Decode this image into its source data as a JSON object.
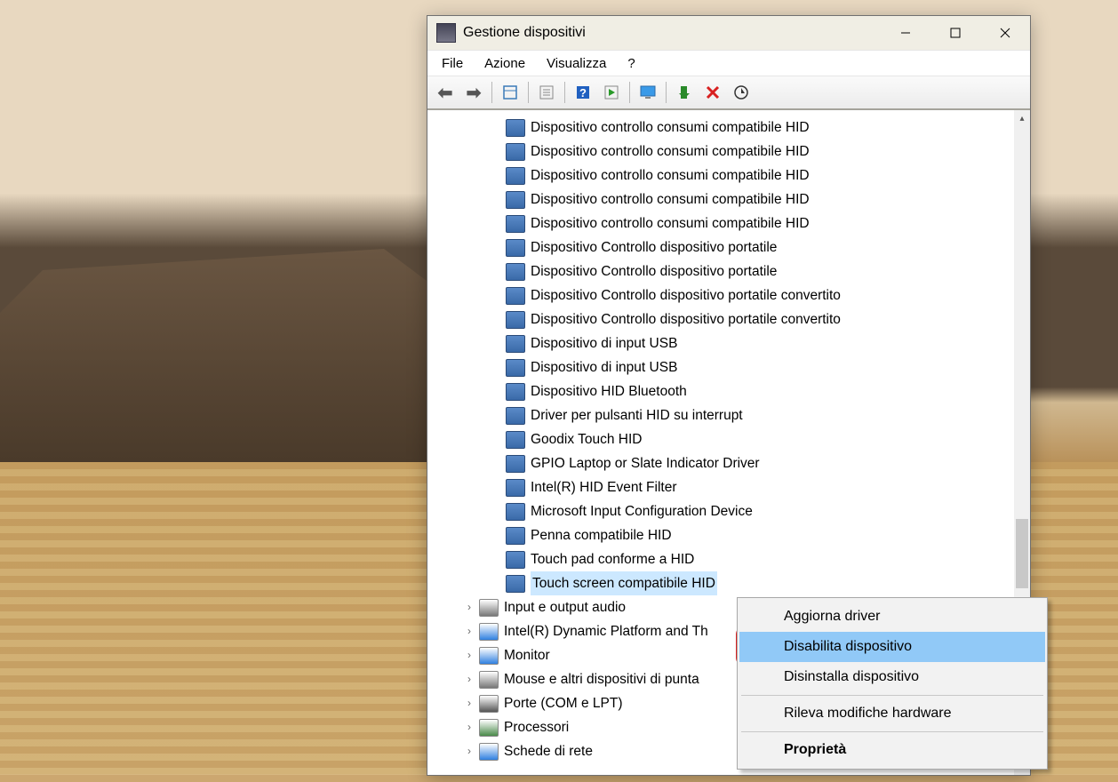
{
  "window": {
    "title": "Gestione dispositivi"
  },
  "menu": {
    "file": "File",
    "action": "Azione",
    "view": "Visualizza",
    "help": "?"
  },
  "toolbar": {
    "back": "◄",
    "forward": "►"
  },
  "devices": [
    {
      "label": "Dispositivo controllo consumi compatibile HID"
    },
    {
      "label": "Dispositivo controllo consumi compatibile HID"
    },
    {
      "label": "Dispositivo controllo consumi compatibile HID"
    },
    {
      "label": "Dispositivo controllo consumi compatibile HID"
    },
    {
      "label": "Dispositivo controllo consumi compatibile HID"
    },
    {
      "label": "Dispositivo Controllo dispositivo portatile"
    },
    {
      "label": "Dispositivo Controllo dispositivo portatile"
    },
    {
      "label": "Dispositivo Controllo dispositivo portatile convertito"
    },
    {
      "label": "Dispositivo Controllo dispositivo portatile convertito"
    },
    {
      "label": "Dispositivo di input USB"
    },
    {
      "label": "Dispositivo di input USB"
    },
    {
      "label": "Dispositivo HID Bluetooth"
    },
    {
      "label": "Driver per pulsanti HID su interrupt"
    },
    {
      "label": "Goodix Touch HID"
    },
    {
      "label": "GPIO Laptop or Slate Indicator Driver"
    },
    {
      "label": "Intel(R) HID Event Filter"
    },
    {
      "label": "Microsoft Input Configuration Device"
    },
    {
      "label": "Penna compatibile HID"
    },
    {
      "label": "Touch pad conforme a HID"
    },
    {
      "label": "Touch screen compatibile HID",
      "selected": true
    }
  ],
  "categories": [
    {
      "label": "Input e output audio",
      "iconColor": "#777"
    },
    {
      "label": "Intel(R) Dynamic Platform and Th",
      "iconColor": "#3080e0"
    },
    {
      "label": "Monitor",
      "iconColor": "#3080e0"
    },
    {
      "label": "Mouse e altri dispositivi di punta",
      "iconColor": "#777"
    },
    {
      "label": "Porte (COM e LPT)",
      "iconColor": "#555"
    },
    {
      "label": "Processori",
      "iconColor": "#4a8a4a"
    },
    {
      "label": "Schede di rete",
      "iconColor": "#3080e0"
    }
  ],
  "context_menu": {
    "update": "Aggiorna driver",
    "disable": "Disabilita dispositivo",
    "uninstall": "Disinstalla dispositivo",
    "scan": "Rileva modifiche hardware",
    "properties": "Proprietà"
  }
}
